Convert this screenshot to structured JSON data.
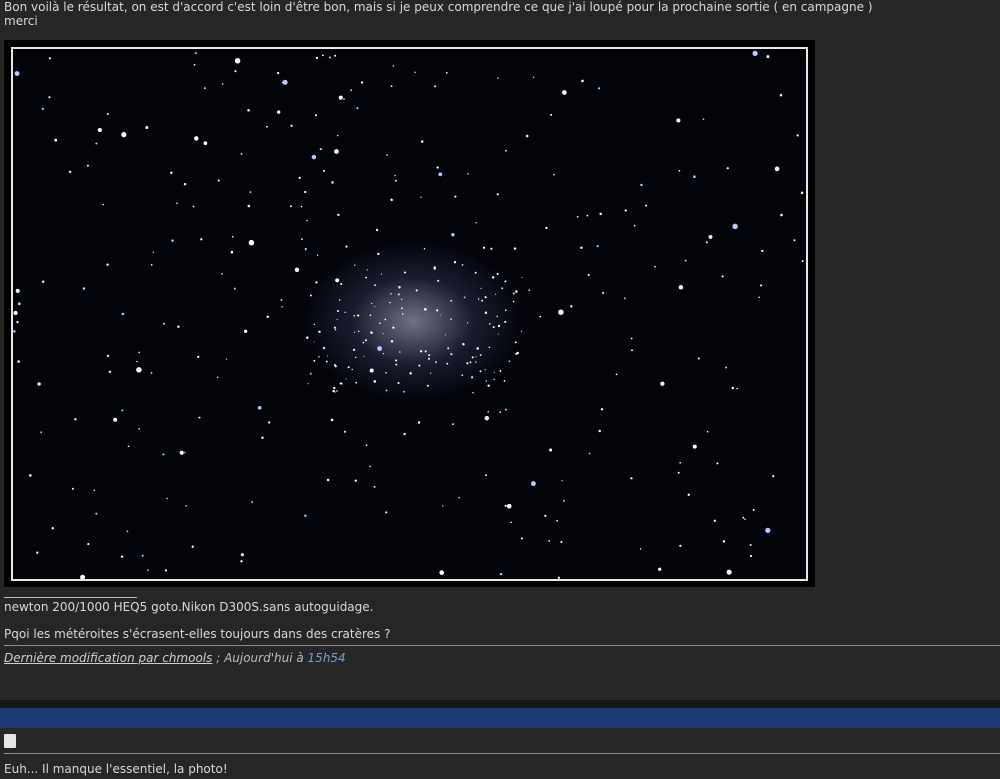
{
  "post": {
    "line1": "Bon voilà le résultat, on est d'accord c'est loin d'être bon, mais si je peux comprendre ce que j'ai loupé pour la prochaine sortie ( en campagne )",
    "line2": "merci"
  },
  "signature": {
    "line1": "newton 200/1000 HEQ5 goto.Nikon D300S.sans autoguidage.",
    "line2": "Pqoi les météroites s'écrasent-elles toujours dans des cratères ?"
  },
  "edit_note": {
    "link": "Dernière modification par chmools",
    "sep": " ; Aujourd'hui à ",
    "time": "15h54"
  },
  "reply": {
    "icon": "post-icon",
    "text": "Euh... Il manque l'essentiel, la photo!"
  },
  "colors": {
    "background": "#262626",
    "header_bar": "#1b3a73",
    "time": "#7f9bc8"
  }
}
